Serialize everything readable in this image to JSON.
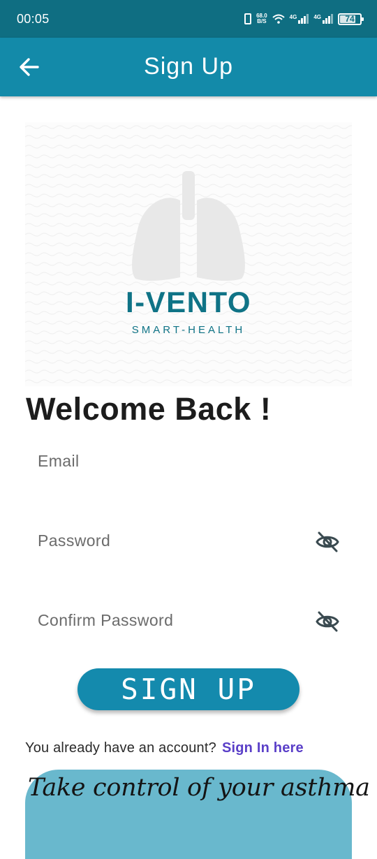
{
  "status_bar": {
    "time": "00:05",
    "net_speed_value": "68.0",
    "net_speed_unit": "B/S",
    "sim1_label": "4G",
    "sim2_label": "4G",
    "battery": "74",
    "icons": [
      "vibrate-icon",
      "wifi-icon",
      "signal-icon",
      "signal-icon",
      "battery-icon"
    ]
  },
  "app_bar": {
    "title": "Sign Up",
    "back_icon": "arrow-left-icon",
    "color": "#138aa9"
  },
  "logo": {
    "brand": "I-VENTO",
    "tagline": "SMART-HEALTH",
    "icon": "lungs-icon",
    "brand_color": "#0f7386"
  },
  "welcome_heading": "Welcome Back !",
  "form": {
    "email_placeholder": "Email",
    "password_placeholder": "Password",
    "confirm_password_placeholder": "Confirm Password",
    "visibility_icon": "eye-off-icon"
  },
  "signup_button": {
    "label": "SIGN UP",
    "color": "#148aad"
  },
  "signin_prompt": {
    "question": "You already have an account?",
    "link": "Sign In here",
    "link_color": "#5a3fc8"
  },
  "promo": {
    "text": "Take control of your asthma",
    "color": "#69b8cd"
  }
}
